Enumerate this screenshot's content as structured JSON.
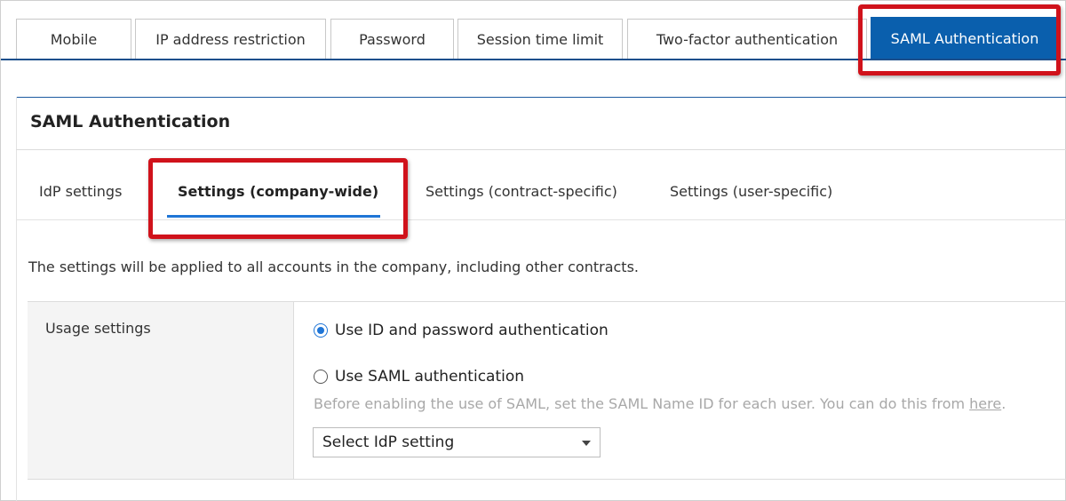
{
  "top_tabs": [
    {
      "label": "Mobile"
    },
    {
      "label": "IP address restriction"
    },
    {
      "label": "Password"
    },
    {
      "label": "Session time limit"
    },
    {
      "label": "Two-factor authentication"
    },
    {
      "label": "SAML Authentication",
      "active": true
    }
  ],
  "section": {
    "title": "SAML Authentication"
  },
  "sub_tabs": [
    {
      "label": "IdP settings"
    },
    {
      "label": "Settings (company-wide)",
      "active": true
    },
    {
      "label": "Settings (contract-specific)"
    },
    {
      "label": "Settings (user-specific)"
    }
  ],
  "description": "The settings will be applied to all accounts in the company, including other contracts.",
  "usage": {
    "label": "Usage settings",
    "options": [
      {
        "label": "Use ID and password authentication",
        "checked": true
      },
      {
        "label": "Use SAML authentication",
        "checked": false
      }
    ],
    "hint_text": "Before enabling the use of SAML, set the SAML Name ID for each user. You can do this from ",
    "hint_link": "here",
    "hint_end": ".",
    "select_value": "Select IdP setting"
  },
  "colors": {
    "accent": "#0a5fad",
    "highlight": "#d0121b",
    "underline": "#1f75d6"
  }
}
